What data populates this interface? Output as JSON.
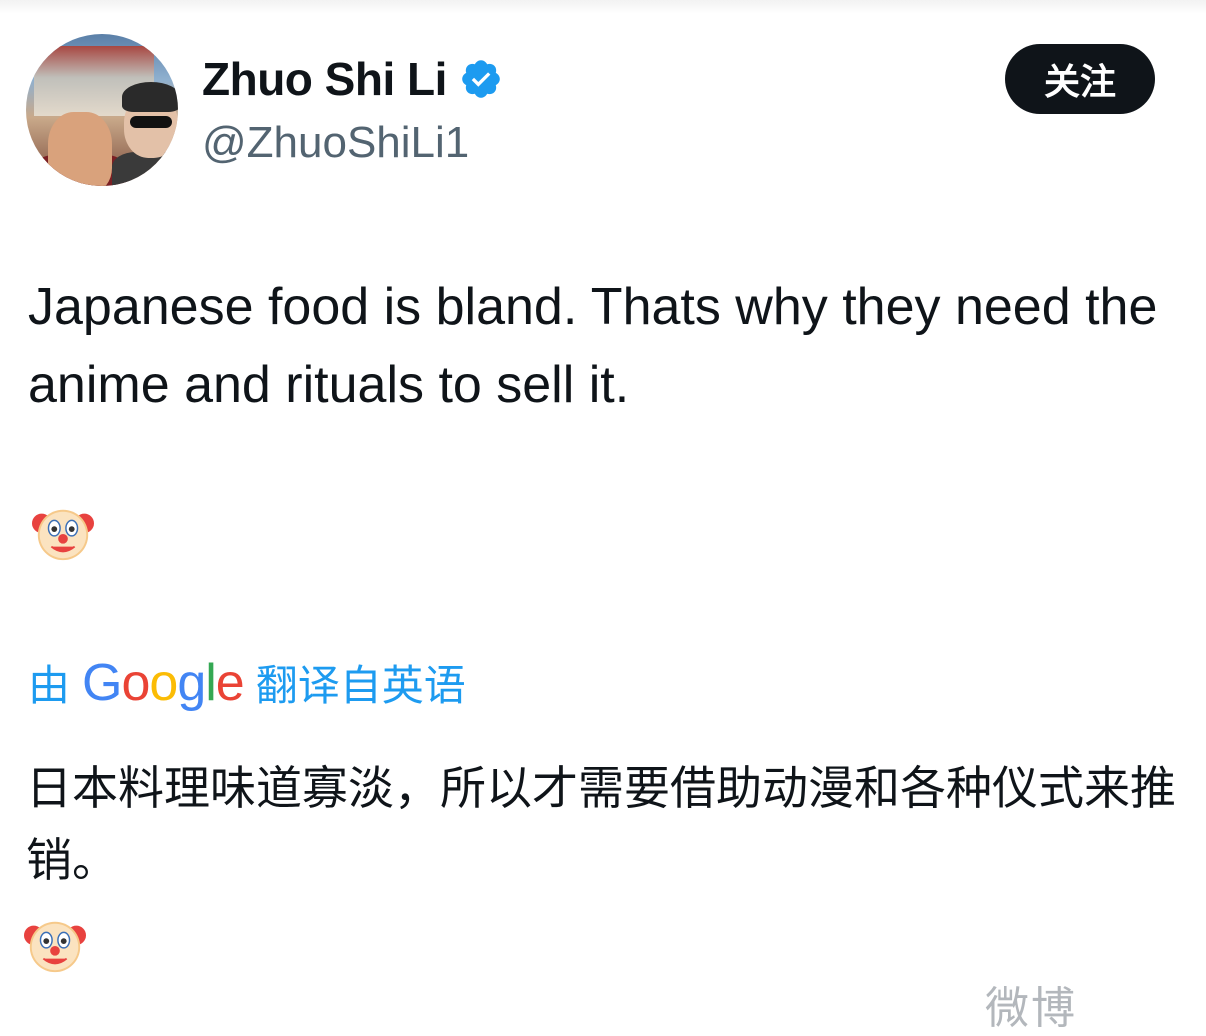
{
  "profile": {
    "display_name": "Zhuo Shi Li",
    "handle": "@ZhuoShiLi1",
    "verified_icon": "verified-badge-icon",
    "avatar_icon": "avatar-photo"
  },
  "actions": {
    "follow_label": "关注"
  },
  "tweet": {
    "text": "Japanese food is bland. Thats why they need the anime and rituals to sell it.",
    "emoji": "🤡"
  },
  "translation": {
    "prefix": "由",
    "google": "Google",
    "suffix": "翻译自英语",
    "text": "日本料理味道寡淡，所以才需要借助动漫和各种仪式来推销。",
    "emoji": "🤡"
  },
  "watermark": {
    "text": "微博"
  },
  "colors": {
    "accent": "#1d9bf0",
    "text": "#0f1419",
    "secondary": "#536471",
    "button_bg": "#0f1419"
  }
}
